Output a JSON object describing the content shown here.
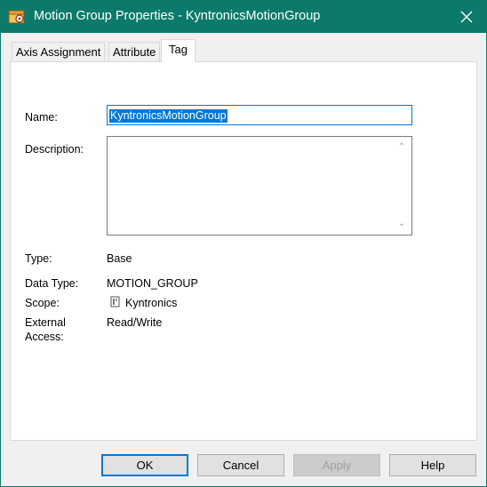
{
  "window": {
    "title": "Motion Group Properties - KyntronicsMotionGroup",
    "accent_color": "#0b7a6a"
  },
  "tabs": [
    {
      "label": "Axis Assignment",
      "active": false
    },
    {
      "label": "Attribute",
      "active": false
    },
    {
      "label": "Tag",
      "active": true
    }
  ],
  "form": {
    "name_label": "Name:",
    "name_value": "KyntronicsMotionGroup",
    "description_label": "Description:",
    "description_value": "",
    "type_label": "Type:",
    "type_value": "Base",
    "data_type_label": "Data Type:",
    "data_type_value": "MOTION_GROUP",
    "scope_label": "Scope:",
    "scope_value": "Kyntronics",
    "external_access_label_line1": "External",
    "external_access_label_line2": "Access:",
    "external_access_value": "Read/Write"
  },
  "buttons": {
    "ok": "OK",
    "cancel": "Cancel",
    "apply": "Apply",
    "help": "Help"
  },
  "icons": {
    "title": "motion-group-icon",
    "close": "close-icon",
    "scope": "controller-icon"
  }
}
